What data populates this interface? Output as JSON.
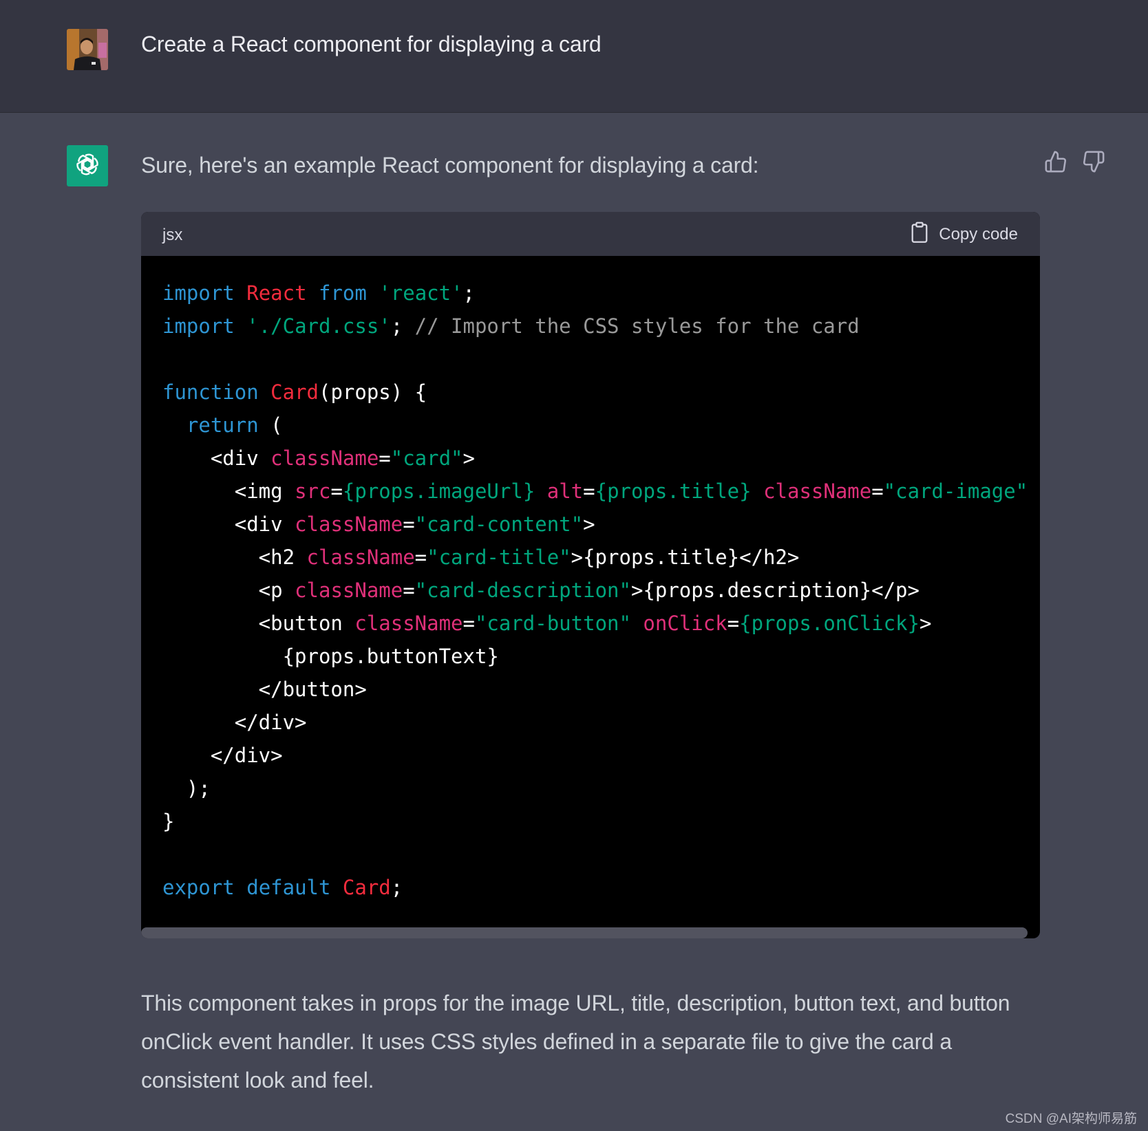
{
  "user_message": {
    "text": "Create a React component for displaying a card"
  },
  "assistant_message": {
    "intro": "Sure, here's an example React component for displaying a card:",
    "code_block": {
      "language": "jsx",
      "copy_label": "Copy code",
      "lines": [
        [
          [
            "kw",
            "import"
          ],
          [
            "plain",
            " "
          ],
          [
            "fn",
            "React"
          ],
          [
            "plain",
            " "
          ],
          [
            "kw",
            "from"
          ],
          [
            "plain",
            " "
          ],
          [
            "str",
            "'react'"
          ],
          [
            "plain",
            ";"
          ]
        ],
        [
          [
            "kw",
            "import"
          ],
          [
            "plain",
            " "
          ],
          [
            "str",
            "'./Card.css'"
          ],
          [
            "plain",
            "; "
          ],
          [
            "cm",
            "// Import the CSS styles for the card"
          ]
        ],
        [],
        [
          [
            "kw",
            "function"
          ],
          [
            "plain",
            " "
          ],
          [
            "fn",
            "Card"
          ],
          [
            "plain",
            "(props) {"
          ]
        ],
        [
          [
            "plain",
            "  "
          ],
          [
            "kw",
            "return"
          ],
          [
            "plain",
            " ("
          ]
        ],
        [
          [
            "plain",
            "    <div "
          ],
          [
            "attr",
            "className"
          ],
          [
            "plain",
            "="
          ],
          [
            "str",
            "\"card\""
          ],
          [
            "plain",
            ">"
          ]
        ],
        [
          [
            "plain",
            "      <img "
          ],
          [
            "attr",
            "src"
          ],
          [
            "plain",
            "="
          ],
          [
            "str",
            "{props.imageUrl}"
          ],
          [
            "plain",
            " "
          ],
          [
            "attr",
            "alt"
          ],
          [
            "plain",
            "="
          ],
          [
            "str",
            "{props.title}"
          ],
          [
            "plain",
            " "
          ],
          [
            "attr",
            "className"
          ],
          [
            "plain",
            "="
          ],
          [
            "str",
            "\"card-image\""
          ],
          [
            "plain",
            " />"
          ]
        ],
        [
          [
            "plain",
            "      <div "
          ],
          [
            "attr",
            "className"
          ],
          [
            "plain",
            "="
          ],
          [
            "str",
            "\"card-content\""
          ],
          [
            "plain",
            ">"
          ]
        ],
        [
          [
            "plain",
            "        <h2 "
          ],
          [
            "attr",
            "className"
          ],
          [
            "plain",
            "="
          ],
          [
            "str",
            "\"card-title\""
          ],
          [
            "plain",
            ">{props.title}</h2>"
          ]
        ],
        [
          [
            "plain",
            "        <p "
          ],
          [
            "attr",
            "className"
          ],
          [
            "plain",
            "="
          ],
          [
            "str",
            "\"card-description\""
          ],
          [
            "plain",
            ">{props.description}</p>"
          ]
        ],
        [
          [
            "plain",
            "        <button "
          ],
          [
            "attr",
            "className"
          ],
          [
            "plain",
            "="
          ],
          [
            "str",
            "\"card-button\""
          ],
          [
            "plain",
            " "
          ],
          [
            "attr",
            "onClick"
          ],
          [
            "plain",
            "="
          ],
          [
            "str",
            "{props.onClick}"
          ],
          [
            "plain",
            ">"
          ]
        ],
        [
          [
            "plain",
            "          {props.buttonText}"
          ]
        ],
        [
          [
            "plain",
            "        </button>"
          ]
        ],
        [
          [
            "plain",
            "      </div>"
          ]
        ],
        [
          [
            "plain",
            "    </div>"
          ]
        ],
        [
          [
            "plain",
            "  );"
          ]
        ],
        [
          [
            "plain",
            "}"
          ]
        ],
        [],
        [
          [
            "kw",
            "export"
          ],
          [
            "plain",
            " "
          ],
          [
            "kw",
            "default"
          ],
          [
            "plain",
            " "
          ],
          [
            "fn",
            "Card"
          ],
          [
            "plain",
            ";"
          ]
        ]
      ]
    },
    "outro": "This component takes in props for the image URL, title, description, button text, and button onClick event handler. It uses CSS styles defined in a separate file to give the card a consistent look and feel."
  },
  "icons": {
    "thumbs_up": "thumbs-up-icon",
    "thumbs_down": "thumbs-down-icon",
    "clipboard": "clipboard-icon",
    "openai_logo": "openai-logo-icon"
  },
  "colors": {
    "keyword": "#2e95d3",
    "function": "#f22c3d",
    "string": "#00a67d",
    "attribute": "#df3079",
    "comment": "#999999",
    "bot_avatar": "#10a37f"
  },
  "watermark": "CSDN @AI架构师易筋"
}
